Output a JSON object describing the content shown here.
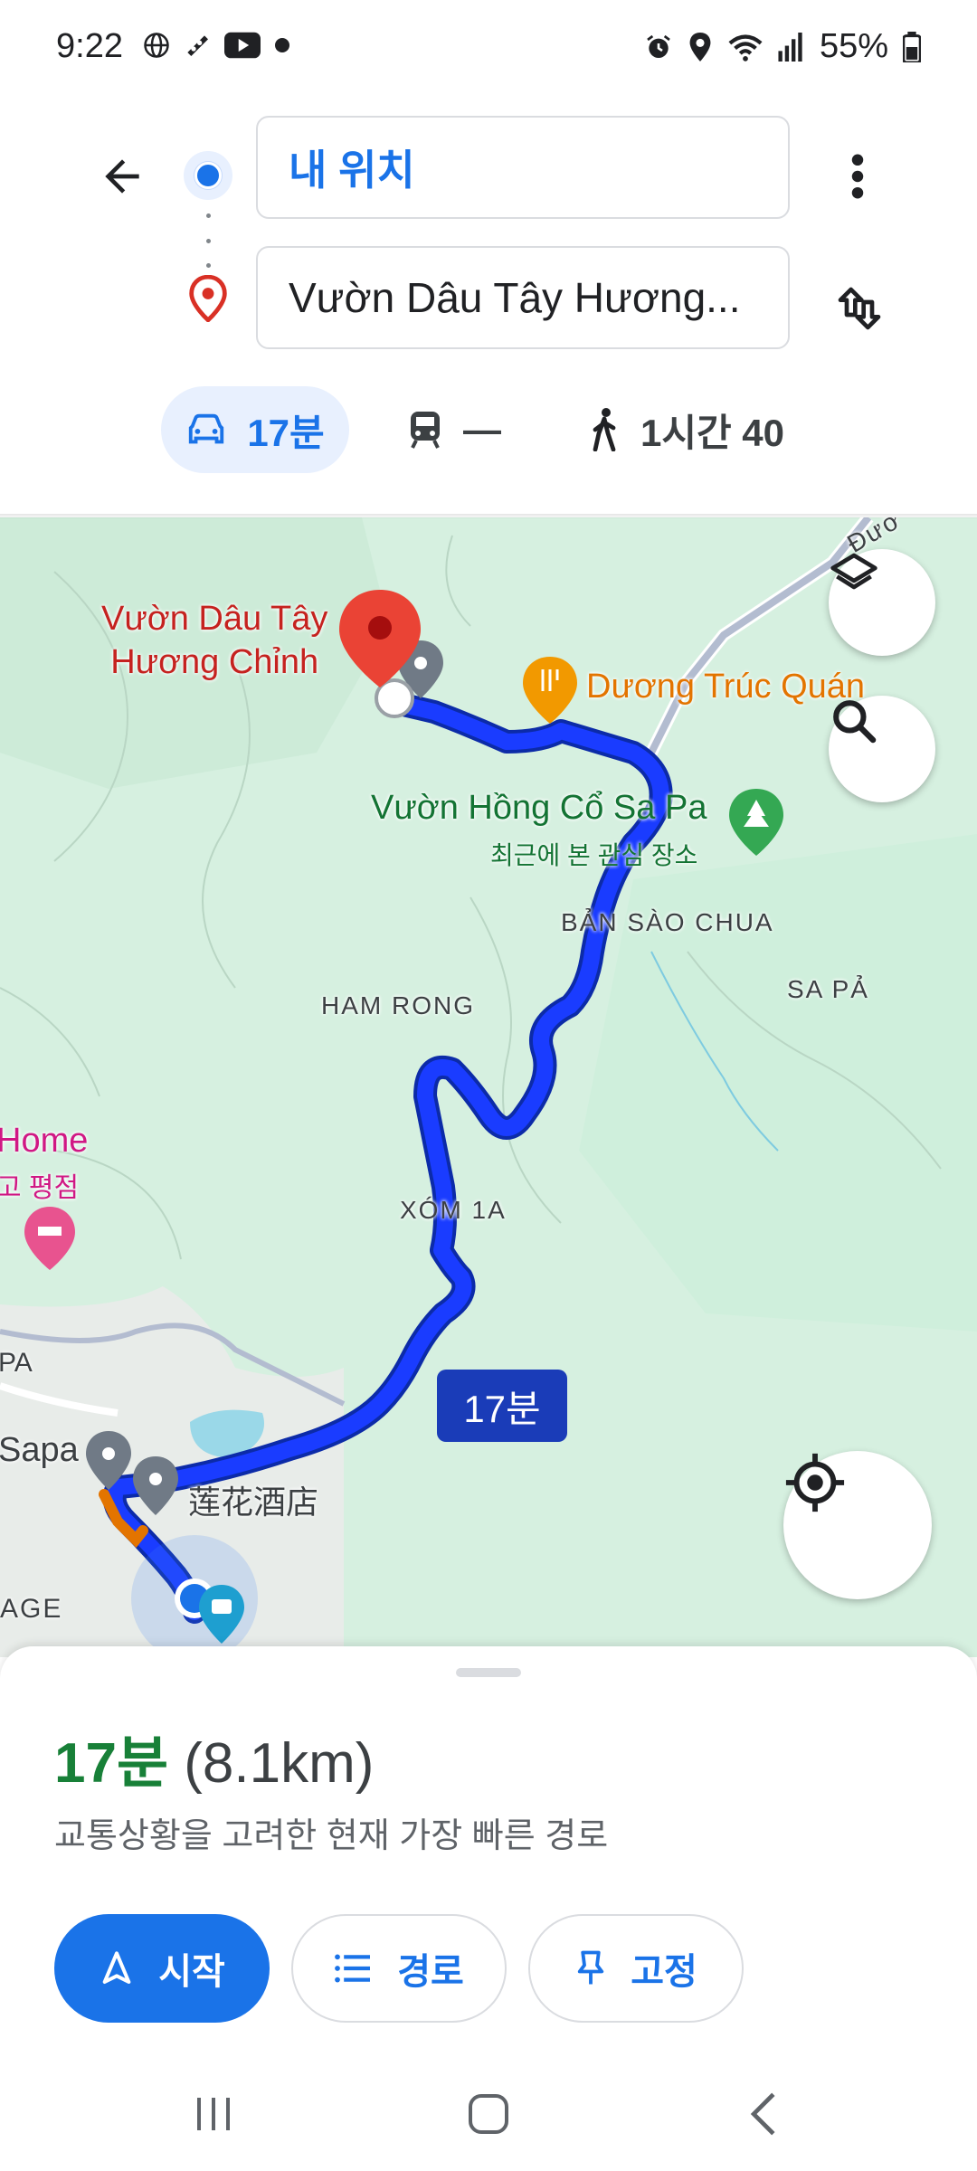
{
  "status_bar": {
    "time": "9:22",
    "battery": "55%",
    "left_icons": [
      "globe-icon",
      "recorder-icon",
      "youtube-icon",
      "dot-icon"
    ],
    "right_icons": [
      "alarm-icon",
      "location-icon",
      "wifi-icon",
      "signal-icon",
      "battery-icon"
    ]
  },
  "header": {
    "origin": "내 위치",
    "destination": "Vườn Dâu Tây Hương..."
  },
  "modes": {
    "car": "17분",
    "transit": "—",
    "walk": "1시간 40"
  },
  "map": {
    "labels": {
      "destination_line1": "Vườn Dâu Tây",
      "destination_line2": "Hương Chỉnh",
      "cafe": "Dương Trúc Quán",
      "garden": "Vườn Hồng Cổ Sa Pa",
      "garden_sub": "최근에 본 관심 장소",
      "ban_sao_chua": "BẢN SÀO CHUA",
      "sa_pa": "SA PẢ",
      "ham_rong": "HAM RONG",
      "xom_1a": "XÓM 1A",
      "home": "Home",
      "home_sub": "고 평점",
      "pa": "PA",
      "sapa": "Sapa",
      "hotel": "莲花酒店",
      "age": "AGE",
      "road": "Đườ"
    },
    "route_time": "17분",
    "colors": {
      "route": "#1a3cff",
      "map_bg": "#d9f2e3",
      "accent": "#1a73e8"
    }
  },
  "sheet": {
    "duration": "17분",
    "distance": "(8.1km)",
    "description": "교통상황을 고려한 현재 가장 빠른 경로",
    "start_label": "시작",
    "steps_label": "경로",
    "pin_label": "고정"
  }
}
